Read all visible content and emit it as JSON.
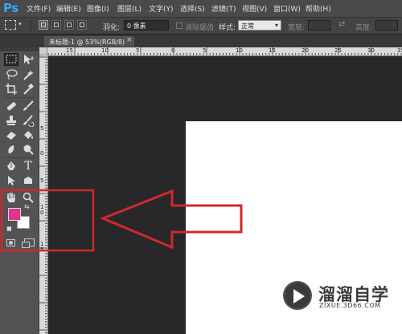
{
  "app": {
    "logo": "Ps"
  },
  "menu": [
    "文件(F)",
    "编辑(E)",
    "图像(I)",
    "图层(L)",
    "文字(Y)",
    "选择(S)",
    "滤镜(T)",
    "视图(V)",
    "窗口(W)",
    "帮助(H)"
  ],
  "options": {
    "feather_label": "羽化:",
    "feather_value": "0 像素",
    "antialias_label": "消除锯齿",
    "style_label": "样式:",
    "style_value": "正常",
    "width_label": "宽度:",
    "height_label": "高度:"
  },
  "document": {
    "tab_title": "未标题-1 @ 53%(RGB/8)",
    "close": "×"
  },
  "ruler": {
    "top_labels": [
      "15",
      "10",
      "5",
      "0",
      "5",
      "10",
      "15",
      "20",
      "25",
      "30",
      "35"
    ],
    "left_labels": [
      "5",
      "0",
      "5",
      "1 0",
      "1 5"
    ]
  },
  "colors": {
    "foreground": "#e0358a",
    "background": "#ffffff",
    "annotation": "#d0282d"
  },
  "tools": [
    "marquee-icon",
    "move-icon",
    "lasso-icon",
    "magic-wand-icon",
    "crop-icon",
    "eyedropper-icon",
    "healing-brush-icon",
    "brush-icon",
    "clone-stamp-icon",
    "history-brush-icon",
    "eraser-icon",
    "paint-bucket-icon",
    "blur-icon",
    "dodge-icon",
    "pen-icon",
    "type-icon",
    "path-selection-icon",
    "shape-icon",
    "hand-icon",
    "zoom-icon"
  ],
  "watermark": {
    "title": "溜溜自学",
    "url": "ZIXUE.3D66.COM"
  }
}
